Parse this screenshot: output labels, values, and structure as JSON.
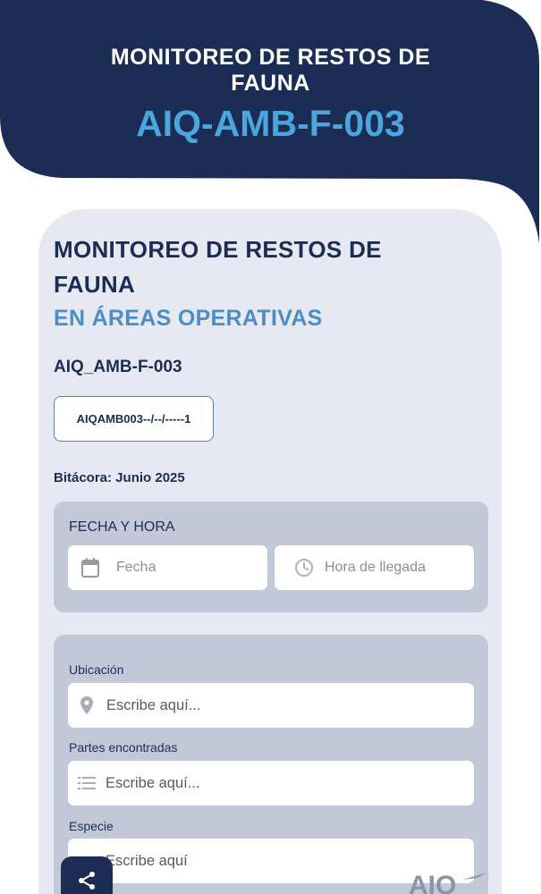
{
  "header": {
    "title": "MONITOREO DE RESTOS DE FAUNA",
    "code": "AIQ-AMB-F-003"
  },
  "card": {
    "title": "MONITOREO DE RESTOS DE FAUNA",
    "subtitle": "EN ÁREAS OPERATIVAS",
    "form_code": "AIQ_AMB-F-003",
    "folio": "AIQAMB003--/--/-----1",
    "bitacora": "Bitácora: Junio 2025"
  },
  "fecha_panel": {
    "label": "FECHA Y HORA",
    "fecha_placeholder": "Fecha",
    "hora_placeholder": "Hora de llegada"
  },
  "location_panel": {
    "ubicacion_label": "Ubicación",
    "ubicacion_placeholder": "Escribe aquí...",
    "partes_label": "Partes encontradas",
    "partes_placeholder": "Escribe aquí...",
    "especie_label": "Especie",
    "especie_placeholder": "Escribe aquí"
  },
  "logo": {
    "text": "AIQ"
  },
  "icons": [
    "calendar-icon",
    "clock-icon",
    "location-pin-icon",
    "list-icon",
    "share-icon"
  ],
  "colors": {
    "navy": "#1b2d55",
    "accent_blue": "#4aa6dc",
    "card_bg": "#e6e9f1",
    "panel_bg": "#c3c8d8"
  }
}
